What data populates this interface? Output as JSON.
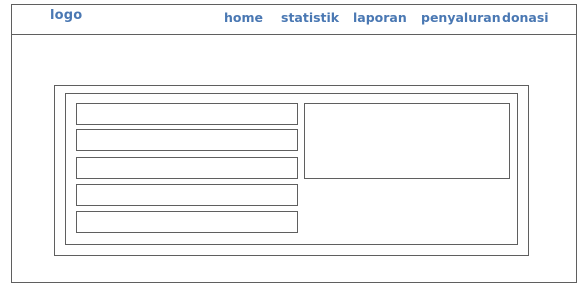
{
  "header": {
    "logo": "logo",
    "nav": {
      "home": "home",
      "statistik": "statistik",
      "laporan": "laporan",
      "penyaluran": "penyaluran",
      "donasi": "donasi"
    }
  },
  "colors": {
    "accent": "#4a78b3",
    "border": "#5f5f5f",
    "background": "#ffffff"
  }
}
